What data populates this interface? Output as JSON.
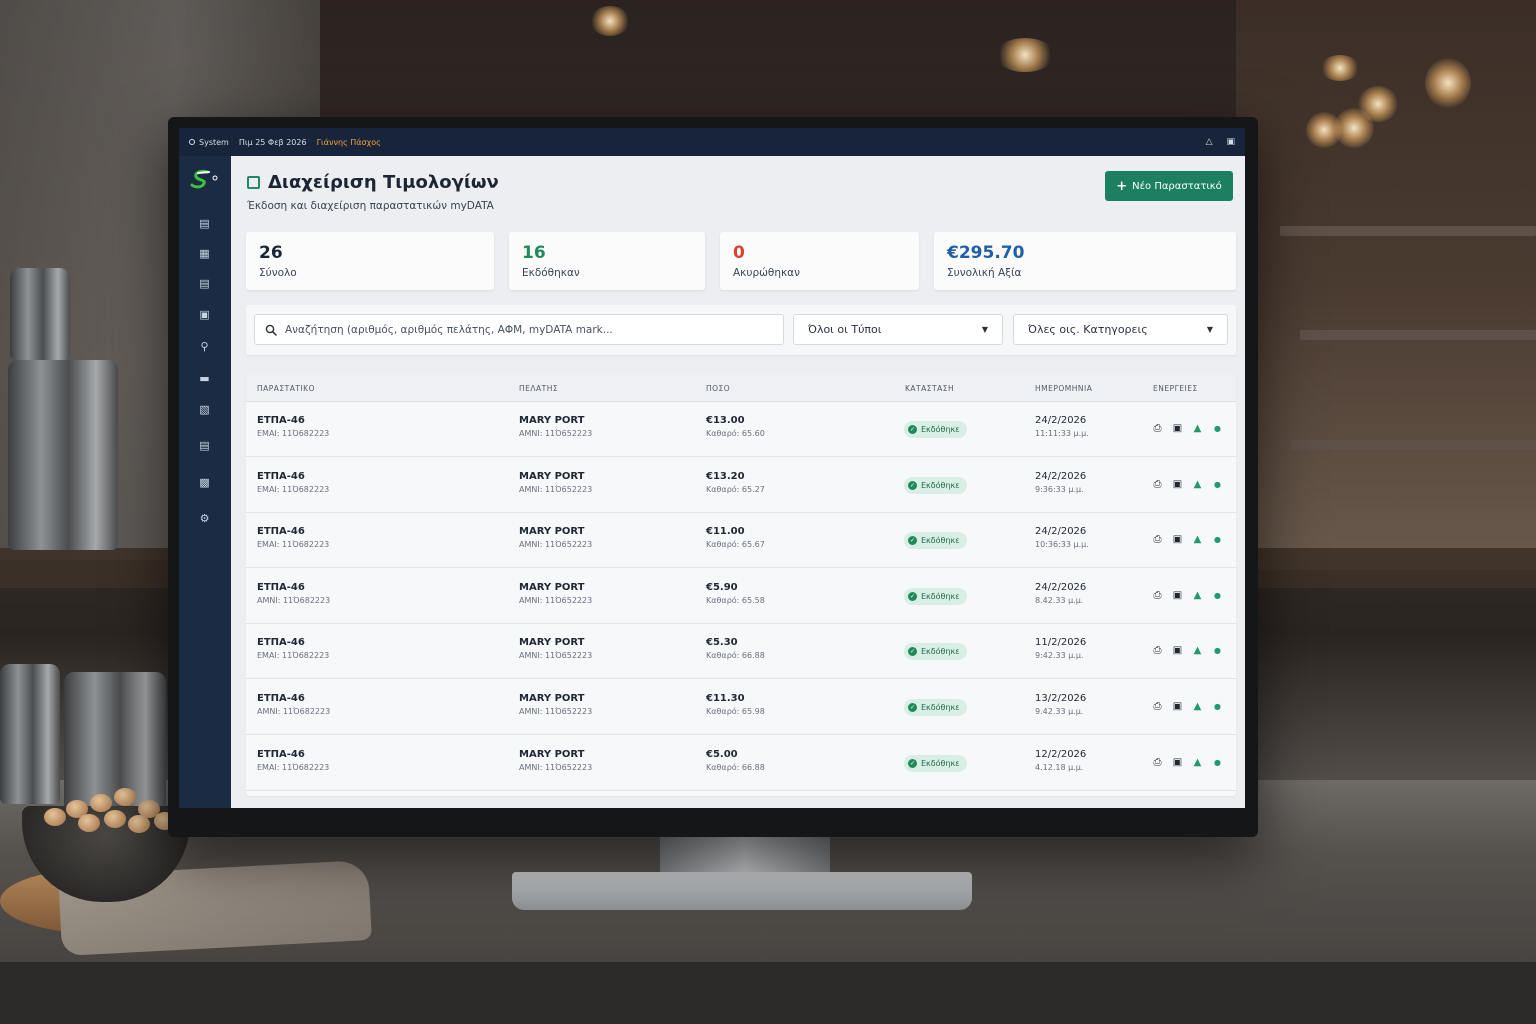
{
  "topbar": {
    "system": "System",
    "date": "Πιμ 25 Φεβ 2026",
    "user": "Γιάννης Πάσχος",
    "icons": [
      "bell-icon",
      "lock-icon"
    ]
  },
  "sidebar": {
    "icons": [
      "document-icon",
      "card-icon",
      "receipt-icon",
      "invoice-icon",
      "search-doc-icon",
      "wallet-icon",
      "clipboard-icon",
      "ledger-icon",
      "folder-icon",
      "settings-icon"
    ]
  },
  "header": {
    "title": "Διαχείριση Τιμολογίων",
    "subtitle": "Έκδοση και διαχείριση παραστατικών myDATA",
    "new_button": "Νέο Παραστατικό"
  },
  "stats": [
    {
      "value": "26",
      "label": "Σύνολο",
      "color": "#1c2533"
    },
    {
      "value": "16",
      "label": "Εκδόθηκαν",
      "color": "#1f8a5c"
    },
    {
      "value": "0",
      "label": "Ακυρώθηκαν",
      "color": "#d8432b"
    },
    {
      "value": "€295.70",
      "label": "Συνολική Αξία",
      "color": "#1f5fa8"
    }
  ],
  "filters": {
    "search_placeholder": "Αναζήτηση (αριθμός, αριθμός πελάτης, ΑΦΜ, myDATA mark...",
    "type_select": "Όλοι οι Τύποι",
    "category_select": "Όλες οις.  Κατηγορεις"
  },
  "table": {
    "headers": [
      "ΠΑΡΑΣΤΑΤΙΚΟ",
      "ΠΕΛΑΤΗΣ",
      "ΠΟΣΟ",
      "ΚΑΤΑΣΤΑΣΗ",
      "ΗΜΕΡΟΜΗΝΙΑ",
      "ΕΝΕΡΓΕΙΕΣ"
    ],
    "rows": [
      {
        "doc": "ΕΤΠΑ-46",
        "doc_sub": "ΕΜΑΙ: 11Ό682223",
        "client": "MARY PORT",
        "client_sub": "ΑΜΝΙ: 11Ό652223",
        "amount": "€13.00",
        "amount_sub": "Καθαρό: 65.60",
        "status": "Εκδόθηκε",
        "date": "24/2/2026",
        "time": "11:11:33 μ.μ."
      },
      {
        "doc": "ΕΤΠΑ-46",
        "doc_sub": "ΕΜΑΙ: 11Ό682223",
        "client": "MARY PORT",
        "client_sub": "ΑΜΝΙ: 11Ό652223",
        "amount": "€13.20",
        "amount_sub": "Καθαρό: 65.27",
        "status": "Εκδόθηκε",
        "date": "24/2/2026",
        "time": "9:36:33 μ.μ."
      },
      {
        "doc": "ΕΤΠΑ-46",
        "doc_sub": "ΕΜΑΙ: 11Ό682223",
        "client": "MARY PORT",
        "client_sub": "ΑΜΝΙ: 11Ό652223",
        "amount": "€11.00",
        "amount_sub": "Καθαρό: 65.67",
        "status": "Εκδόθηκε",
        "date": "24/2/2026",
        "time": "10:36:33 μ.μ."
      },
      {
        "doc": "ΕΤΠΑ-46",
        "doc_sub": "ΑΜΝΙ: 11Ό682223",
        "client": "MARY PORT",
        "client_sub": "ΑΜΝΙ: 11Ό652223",
        "amount": "€5.90",
        "amount_sub": "Καθαρό: 65.58",
        "status": "Εκδόθηκε",
        "date": "24/2/2026",
        "time": "8.42.33 μ.μ."
      },
      {
        "doc": "ΕΤΠΑ-46",
        "doc_sub": "ΕΜΑΙ: 11Ό682223",
        "client": "MARY PORT",
        "client_sub": "ΑΜΝΙ: 11Ό652223",
        "amount": "€5.30",
        "amount_sub": "Καθαρό: 66.88",
        "status": "Εκδόθηκε",
        "date": "11/2/2026",
        "time": "9:42.33 μ.μ."
      },
      {
        "doc": "ΕΤΠΑ-46",
        "doc_sub": "ΑΜΝΙ: 11Ό682223",
        "client": "MARY PORT",
        "client_sub": "ΑΜΝΙ: 11Ό652223",
        "amount": "€11.30",
        "amount_sub": "Καθαρό: 65.98",
        "status": "Εκδόθηκε",
        "date": "13/2/2026",
        "time": "9.42.33 μ.μ."
      },
      {
        "doc": "ΕΤΠΑ-46",
        "doc_sub": "ΕΜΑΙ: 11Ό682223",
        "client": "MARY PORT",
        "client_sub": "ΑΜΝΙ: 11Ό652223",
        "amount": "€5.00",
        "amount_sub": "Καθαρό: 66.88",
        "status": "Εκδόθηκε",
        "date": "12/2/2026",
        "time": "4.12.18 μ.μ."
      }
    ],
    "row_actions": [
      "print-icon",
      "pdf-icon",
      "send-icon",
      "cancel-icon"
    ]
  },
  "colors": {
    "accent": "#1b7f60",
    "topbar": "#17243a",
    "sidebar": "#1b2b44",
    "status_bg": "#d9efe5"
  }
}
